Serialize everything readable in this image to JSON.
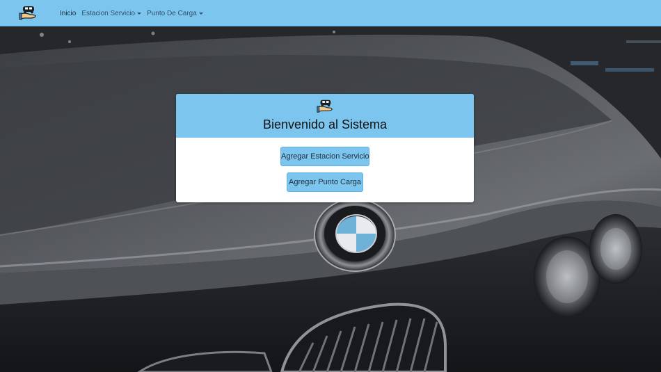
{
  "navbar": {
    "brand_icon": "hand-car-logo-icon",
    "links": [
      {
        "label": "Inicio",
        "active": true,
        "dropdown": false
      },
      {
        "label": "Estacion Servicio",
        "active": false,
        "dropdown": true
      },
      {
        "label": "Punto De Carga",
        "active": false,
        "dropdown": true
      }
    ],
    "background": "#7cc5ee"
  },
  "welcome_card": {
    "logo_icon": "hand-car-logo-icon",
    "title": "Bienvenido al Sistema",
    "buttons": {
      "add_station": "Agregar Estacion Servicio",
      "add_charge_point": "Agregar Punto Carga"
    },
    "header_color": "#7cc5ee"
  },
  "background_image": "car-front-grille-photo"
}
